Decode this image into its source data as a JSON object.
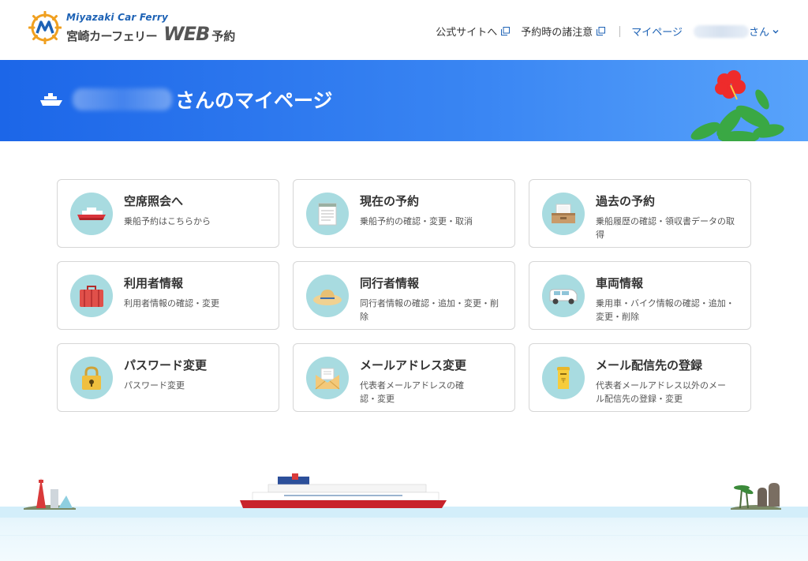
{
  "header": {
    "logo_en": "Miyazaki Car Ferry",
    "logo_ja": "宮崎カーフェリー",
    "logo_web": "WEB",
    "logo_yoyaku": "予約",
    "nav": {
      "official_site": "公式サイトへ",
      "notes": "予約時の諸注意",
      "mypage": "マイページ",
      "user_suffix": "さん"
    }
  },
  "banner": {
    "title_suffix": "さんのマイページ"
  },
  "cards": [
    {
      "title": "空席照会へ",
      "desc": "乗船予約はこちらから",
      "icon": "ferry-icon"
    },
    {
      "title": "現在の予約",
      "desc": "乗船予約の確認・変更・取消",
      "icon": "notepad-icon"
    },
    {
      "title": "過去の予約",
      "desc": "乗船履歴の確認・領収書データの取得",
      "icon": "archive-box-icon"
    },
    {
      "title": "利用者情報",
      "desc": "利用者情報の確認・変更",
      "icon": "suitcase-icon"
    },
    {
      "title": "同行者情報",
      "desc": "同行者情報の確認・追加・変更・削除",
      "icon": "straw-hat-icon"
    },
    {
      "title": "車両情報",
      "desc": "乗用車・バイク情報の確認・追加・変更・削除",
      "icon": "car-icon"
    },
    {
      "title": "パスワード変更",
      "desc": "パスワード変更",
      "icon": "padlock-icon"
    },
    {
      "title": "メールアドレス変更",
      "desc": "代表者メールアドレスの確認・変更",
      "icon": "envelope-icon"
    },
    {
      "title": "メール配信先の登録",
      "desc": "代表者メールアドレス以外のメール配信先の登録・変更",
      "icon": "mailbox-icon"
    }
  ],
  "colors": {
    "brand_blue": "#1d62b5",
    "banner_blue": "#1c66e8",
    "icon_circle": "#a8dbe0"
  }
}
